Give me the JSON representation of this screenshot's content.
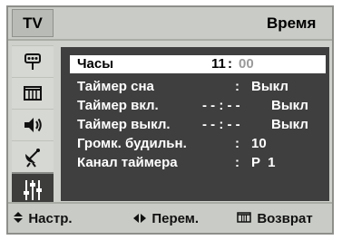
{
  "header": {
    "tv_label": "TV",
    "title": "Время"
  },
  "sidebar": {
    "icons": [
      "antenna-icon",
      "picture-icon",
      "speaker-icon",
      "satellite-icon",
      "settings-icon"
    ],
    "active_index": 4
  },
  "menu": {
    "rows": [
      {
        "label": "Часы",
        "value": "11",
        "sep": ":",
        "value2": "00",
        "selected": true
      },
      {
        "label": "Таймер сна",
        "value": ":",
        "value2": "Выкл",
        "selected": false
      },
      {
        "label": "Таймер вкл.",
        "value": "- - : - -",
        "value2": "Выкл",
        "selected": false
      },
      {
        "label": "Таймер выкл.",
        "value": "- - : - -",
        "value2": "Выкл",
        "selected": false
      },
      {
        "label": "Громк. будильн.",
        "value": ":",
        "value2": "10",
        "selected": false
      },
      {
        "label": "Канал таймера",
        "value": ":",
        "value2": "P  1",
        "selected": false
      }
    ]
  },
  "footer": {
    "adjust": {
      "icon": "up-down-arrows-icon",
      "label": "Настр."
    },
    "move": {
      "icon": "left-right-arrows-icon",
      "label": "Перем."
    },
    "return": {
      "icon": "menu-icon",
      "label": "Возврат"
    }
  }
}
